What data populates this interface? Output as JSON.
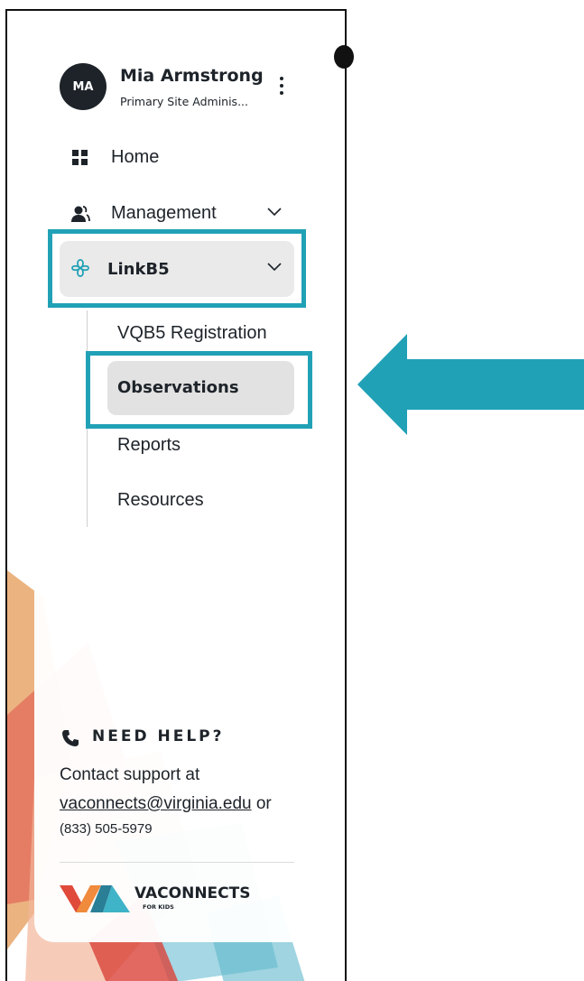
{
  "user": {
    "initials": "MA",
    "name": "Mia Armstrong",
    "role": "Primary Site Adminis..."
  },
  "nav": {
    "home": "Home",
    "management": "Management",
    "linkb5": "LinkB5"
  },
  "submenu": {
    "registration": "VQB5 Registration",
    "observations": "Observations",
    "reports": "Reports",
    "resources": "Resources"
  },
  "help": {
    "heading": "NEED HELP?",
    "line1": "Contact support at",
    "email": "vaconnects@virginia.edu",
    "or": "or",
    "phone": "(833) 505-5979"
  },
  "logo": {
    "name": "VACONNECTS",
    "tagline": "FOR KIDS"
  },
  "colors": {
    "highlight": "#21a1b6",
    "text": "#1d2329"
  },
  "icons": [
    "kebab-menu-icon",
    "grid-icon",
    "users-icon",
    "linkb5-icon",
    "chevron-down-icon",
    "phone-icon",
    "arrow-left-icon"
  ]
}
